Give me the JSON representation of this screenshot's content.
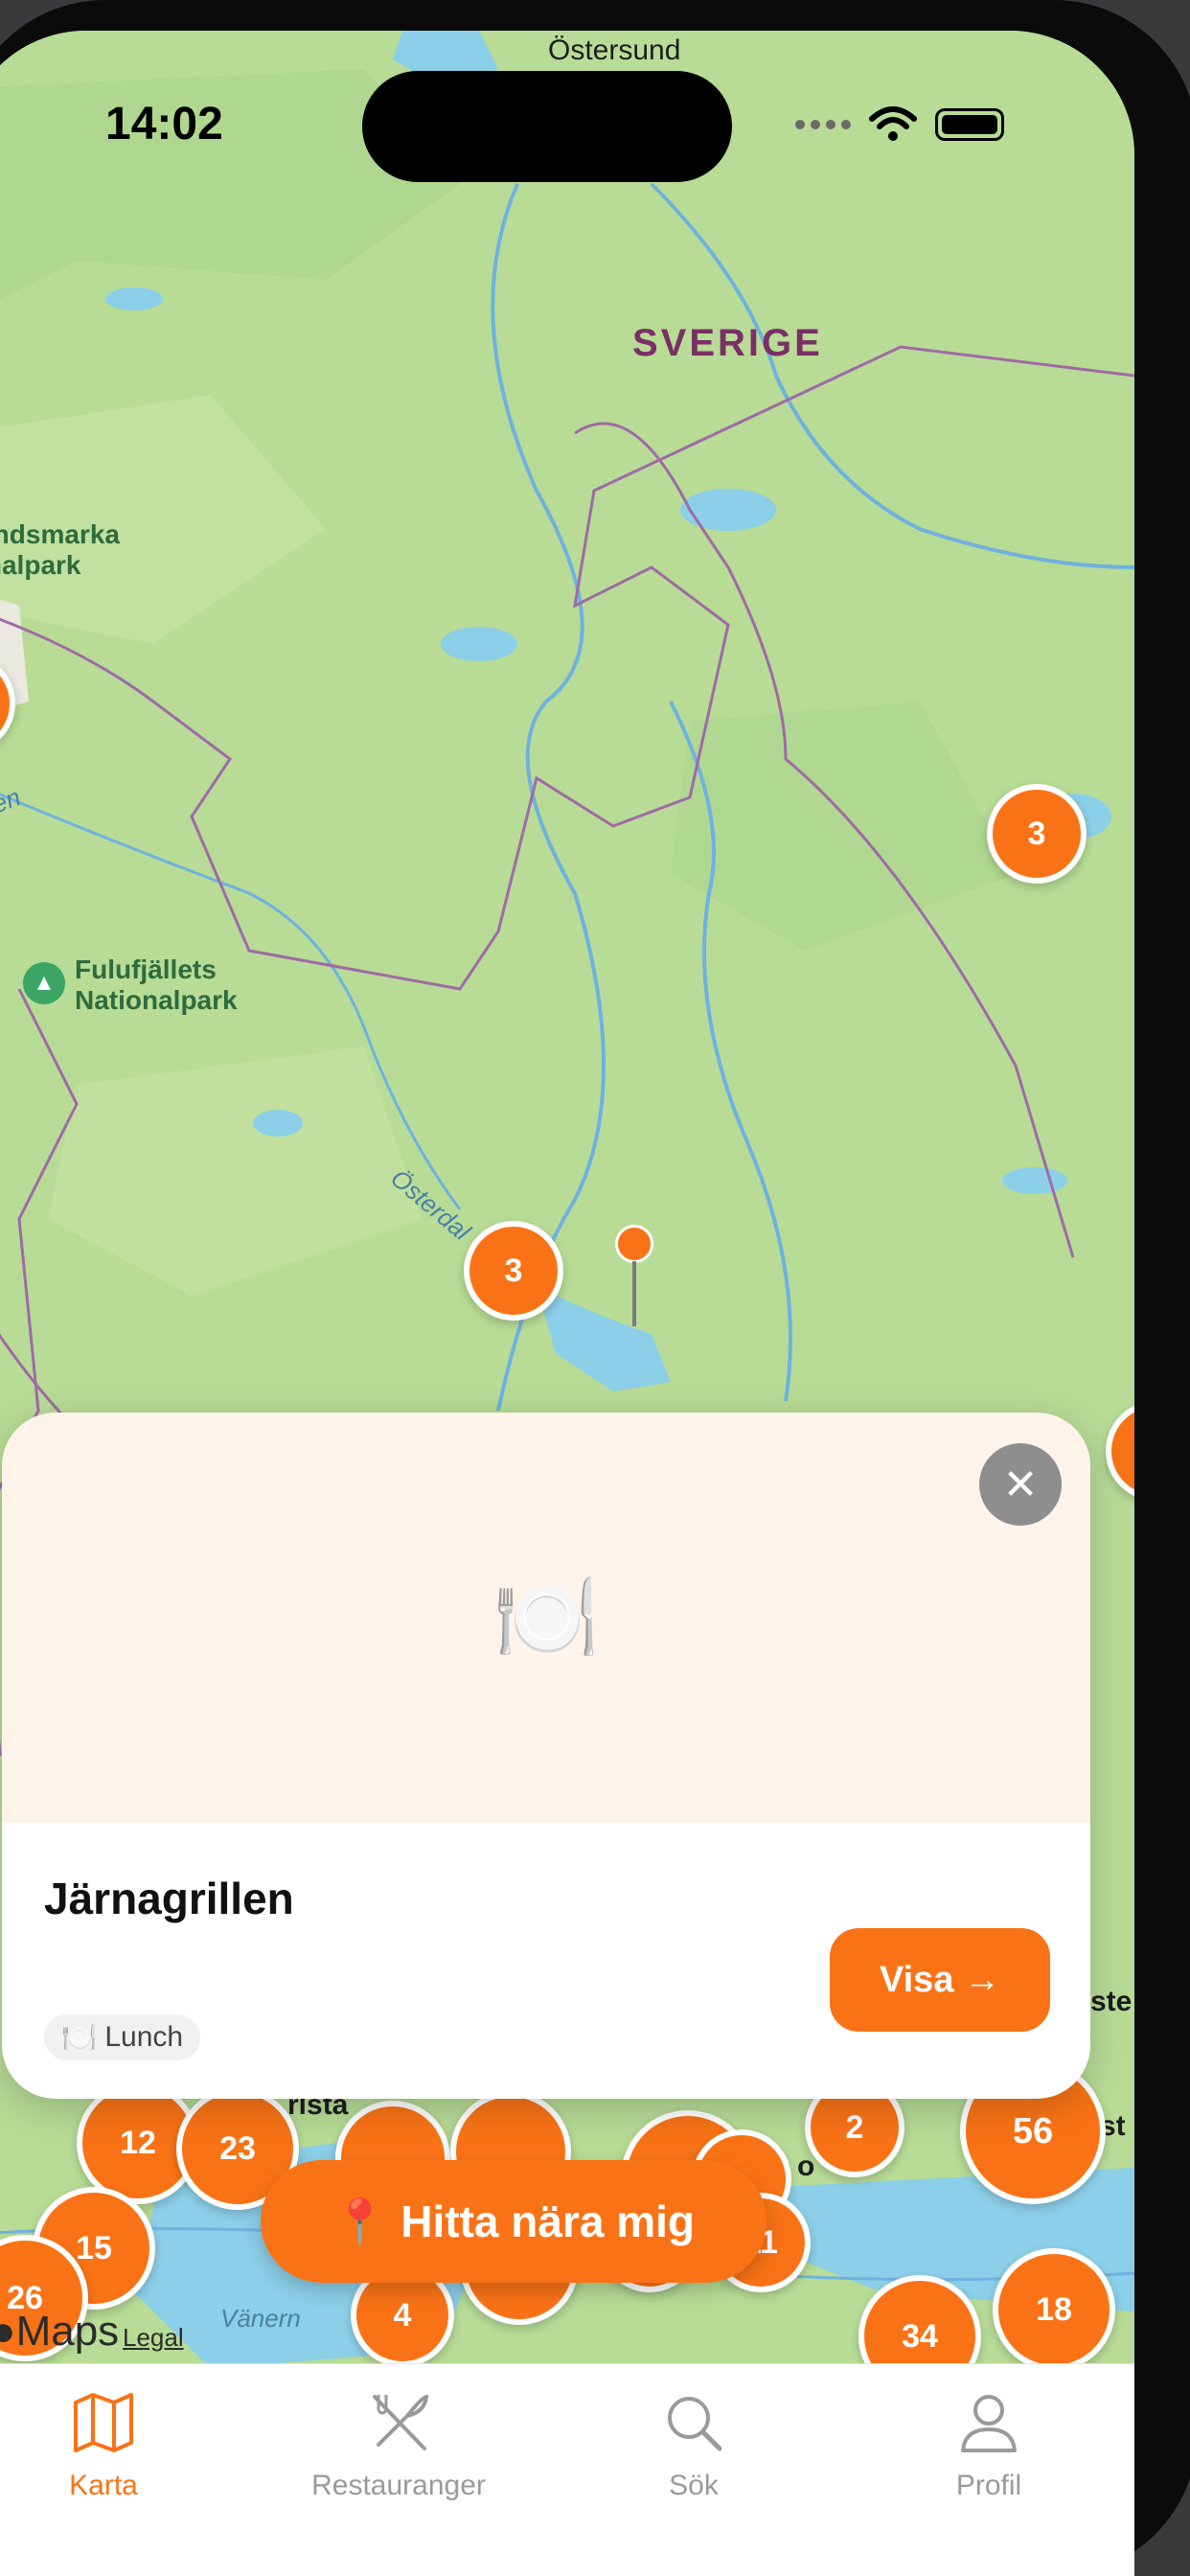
{
  "status": {
    "time": "14:02"
  },
  "map": {
    "city_label": "Östersund",
    "country_label": "SVERIGE",
    "park_1": "aundsmarka\nionalpark",
    "park_2": "Fulufjällets\nNationalpark",
    "water_1": "Österdal",
    "water_2": "alven",
    "water_3": "Vänern",
    "partial_labels": [
      "rlsta",
      "o",
      "ste",
      "st"
    ],
    "clusters": [
      "3",
      "3",
      "12",
      "23",
      "15",
      "26",
      "4",
      "12",
      "2",
      "56",
      "34",
      "18",
      "11"
    ],
    "attribution": "Maps",
    "legal": "Legal"
  },
  "card": {
    "title": "Järnagrillen",
    "image_emoji": "🍽️",
    "tag_emoji": "🍽️",
    "tag": "Lunch",
    "action": "Visa →",
    "close": "✕"
  },
  "near_button": {
    "icon": "📍",
    "label": "Hitta nära mig"
  },
  "tabs": [
    {
      "label": "Karta",
      "icon": "map-icon",
      "active": true
    },
    {
      "label": "Restauranger",
      "icon": "fork-knife-icon",
      "active": false
    },
    {
      "label": "Sök",
      "icon": "search-icon",
      "active": false
    },
    {
      "label": "Profil",
      "icon": "person-icon",
      "active": false
    }
  ],
  "colors": {
    "accent": "#f97316",
    "map_green": "#b8dc96",
    "water": "#8ccfe8"
  }
}
